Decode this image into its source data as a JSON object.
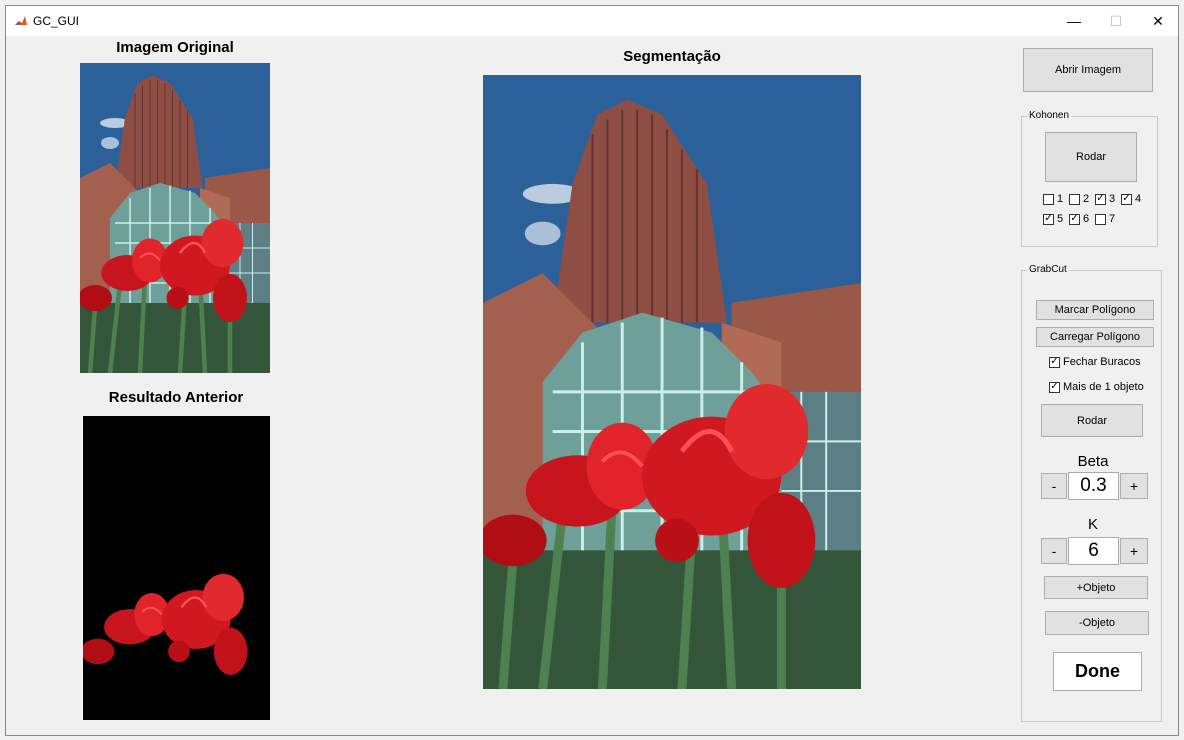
{
  "window": {
    "title": "GC_GUI",
    "min_glyph": "—",
    "max_glyph": "☐",
    "close_glyph": "✕"
  },
  "panels": {
    "original_title": "Imagem Original",
    "previous_title": "Resultado Anterior",
    "segmentation_title": "Segmentação"
  },
  "controls": {
    "open_image": "Abrir Imagem",
    "kohonen": {
      "title": "Kohonen",
      "run": "Rodar",
      "checks": [
        {
          "label": "1",
          "checked": false
        },
        {
          "label": "2",
          "checked": false
        },
        {
          "label": "3",
          "checked": true
        },
        {
          "label": "4",
          "checked": true
        },
        {
          "label": "5",
          "checked": true
        },
        {
          "label": "6",
          "checked": true
        },
        {
          "label": "7",
          "checked": false
        }
      ]
    },
    "grabcut": {
      "title": "GrabCut",
      "mark_polygon": "Marcar Polígono",
      "load_polygon": "Carregar Polígono",
      "fill_holes": {
        "label": "Fechar Buracos",
        "checked": true
      },
      "multi_object": {
        "label": "Mais de 1 objeto",
        "checked": true
      },
      "run": "Rodar",
      "beta": {
        "label": "Beta",
        "value": "0.3",
        "minus": "-",
        "plus": "+"
      },
      "k": {
        "label": "K",
        "value": "6",
        "minus": "-",
        "plus": "+"
      },
      "add_object": "+Objeto",
      "remove_object": "-Objeto"
    },
    "done": "Done"
  },
  "colors": {
    "sky": "#2a5f93",
    "brick": "#a35f4e",
    "tulip": "#d81820",
    "glass": "#7fb9ae",
    "result_bg": "#000000"
  }
}
